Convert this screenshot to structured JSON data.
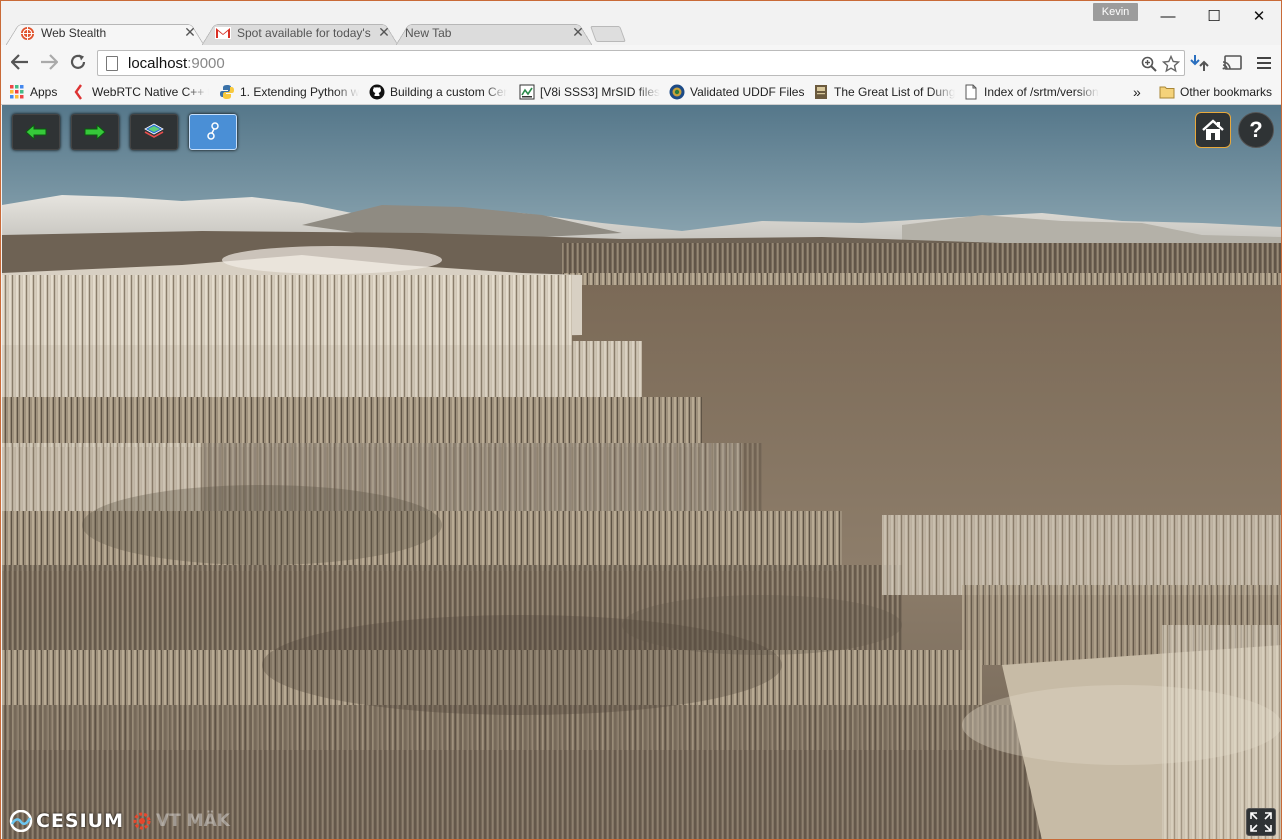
{
  "tabs": [
    {
      "label": "Web Stealth",
      "icon": "globe-icon",
      "active": true
    },
    {
      "label": "Spot available for today's",
      "icon": "gmail-icon",
      "active": false
    },
    {
      "label": "New Tab",
      "icon": "",
      "active": false
    }
  ],
  "profile": {
    "name": "Kevin"
  },
  "window_controls": {
    "minimize": "—",
    "maximize": "☐",
    "close": "✕"
  },
  "address": {
    "host": "localhost",
    "port": ":9000"
  },
  "bookmarks": [
    {
      "label": "Apps",
      "icon": "apps-grid-icon"
    },
    {
      "label": "WebRTC Native C++ t",
      "icon": "webrtc-icon"
    },
    {
      "label": "1. Extending Python w",
      "icon": "python-icon"
    },
    {
      "label": "Building a custom Cer",
      "icon": "github-icon"
    },
    {
      "label": "[V8i SSS3] MrSID files",
      "icon": "doc-icon"
    },
    {
      "label": "Validated UDDF Files",
      "icon": "seal-icon"
    },
    {
      "label": "The Great List of Dung",
      "icon": "book-icon"
    },
    {
      "label": "Index of /srtm/version",
      "icon": "page-icon"
    },
    {
      "label": "»",
      "icon": ""
    },
    {
      "label": "Other bookmarks",
      "icon": "folder-icon"
    }
  ],
  "cesium": {
    "logo_text": "CESIUM",
    "mak_text": "VT MÄK",
    "help_label": "?"
  },
  "colors": {
    "frame": "#c96a37",
    "cesium_button": "#2f3335",
    "cesium_selected": "#4a8fd6",
    "home_border": "#e9a93b"
  }
}
